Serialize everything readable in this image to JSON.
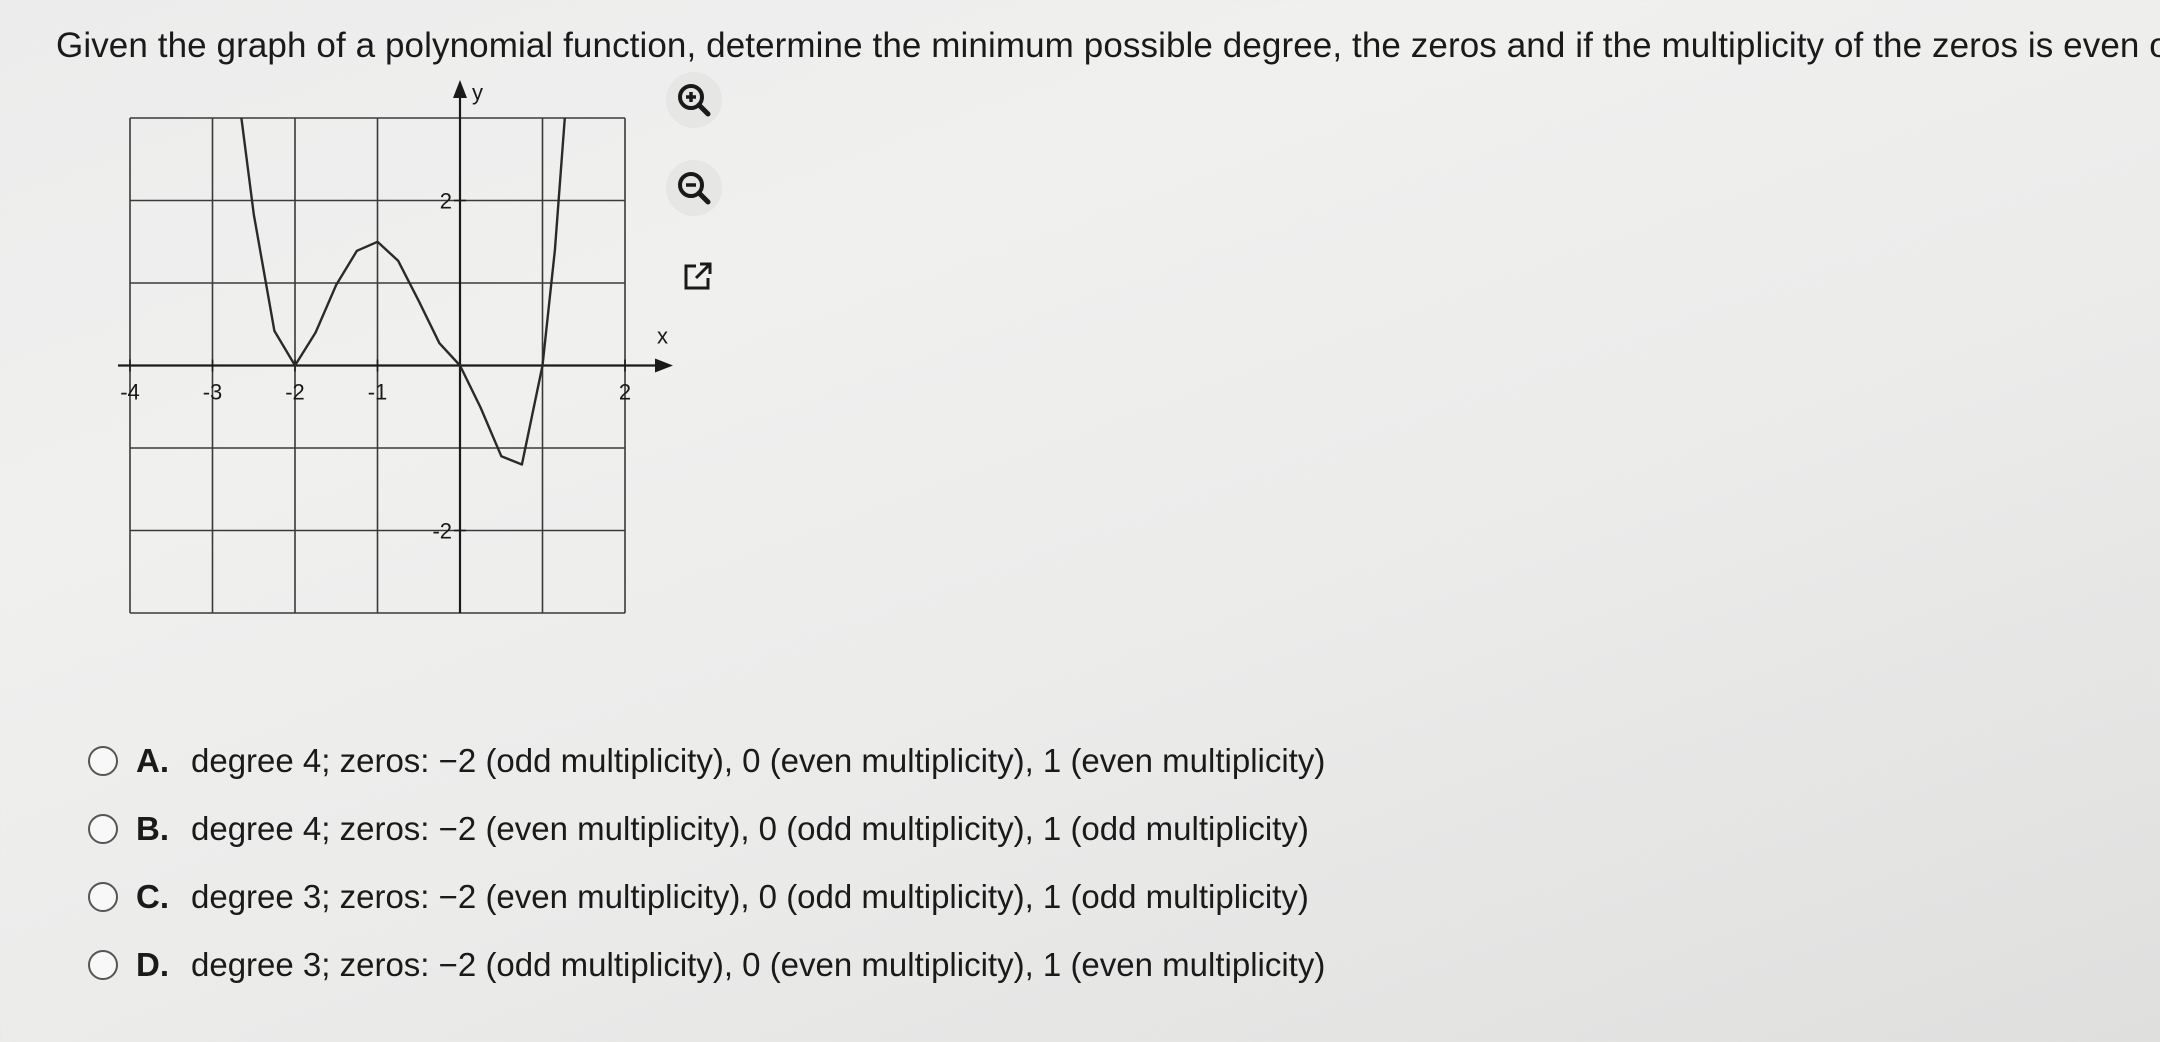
{
  "question": "Given the graph of a polynomial function, determine the minimum possible degree, the zeros and if the multiplicity of the zeros is even or odd.",
  "toolbar": {
    "zoom_in_icon": "zoom-in-icon",
    "zoom_out_icon": "zoom-out-icon",
    "popout_icon": "external-link-icon"
  },
  "colors": {
    "curve": "#2a2a2a",
    "grid": "#3a3a3a",
    "background": "#ececec"
  },
  "chart_data": {
    "type": "line",
    "title": "",
    "xlabel": "x",
    "ylabel": "y",
    "xlim": [
      -4,
      2
    ],
    "ylim": [
      -3,
      3
    ],
    "grid": true,
    "x_tick_labels": [
      "-4",
      "-3",
      "-2",
      "-1",
      "2"
    ],
    "y_tick_labels": [
      "2",
      "-2"
    ],
    "series": [
      {
        "points": [
          [
            -2.65,
            3.0
          ],
          [
            -2.5,
            1.83
          ],
          [
            -2.25,
            0.42
          ],
          [
            -2.0,
            0.0
          ],
          [
            -1.75,
            0.4
          ],
          [
            -1.5,
            0.98
          ],
          [
            -1.25,
            1.39
          ],
          [
            -1.0,
            1.5
          ],
          [
            -0.75,
            1.27
          ],
          [
            -0.5,
            0.78
          ],
          [
            -0.25,
            0.27
          ],
          [
            0.0,
            0.0
          ],
          [
            0.25,
            -0.51
          ],
          [
            0.5,
            -1.1
          ],
          [
            0.75,
            -1.2
          ],
          [
            1.0,
            0.0
          ],
          [
            1.15,
            1.4
          ],
          [
            1.27,
            3.0
          ]
        ]
      }
    ]
  },
  "options": [
    {
      "letter": "A.",
      "text": "degree 4;  zeros:  −2 (odd multiplicity), 0 (even multiplicity), 1 (even multiplicity)"
    },
    {
      "letter": "B.",
      "text": "degree 4;  zeros:  −2 (even multiplicity), 0 (odd multiplicity), 1 (odd multiplicity)"
    },
    {
      "letter": "C.",
      "text": "degree 3;  zeros:  −2 (even multiplicity), 0 (odd multiplicity), 1 (odd multiplicity)"
    },
    {
      "letter": "D.",
      "text": "degree 3;  zeros:  −2 (odd multiplicity), 0 (even multiplicity), 1 (even multiplicity)"
    }
  ]
}
